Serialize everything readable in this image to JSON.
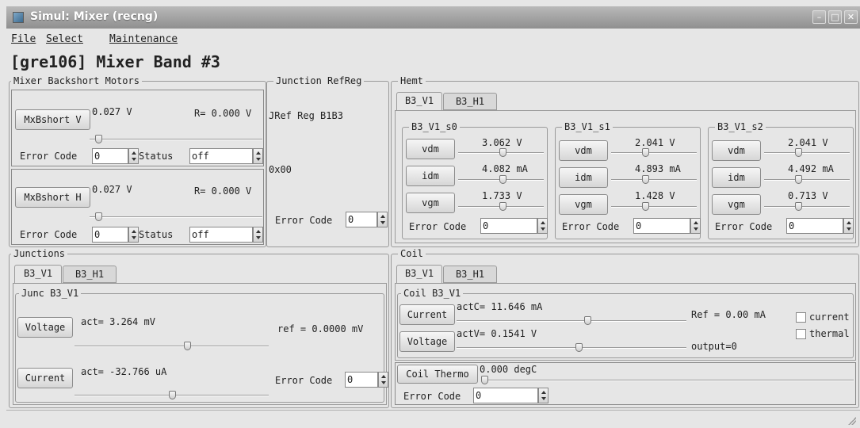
{
  "window": {
    "title": "Simul: Mixer (recng)"
  },
  "menu": {
    "file": "File",
    "select": "Select",
    "maintenance": "Maintenance"
  },
  "heading": "[gre106] Mixer Band #3",
  "motors": {
    "title": "Mixer Backshort Motors",
    "v": {
      "btn": "MxBshort V",
      "volt": "0.027 V",
      "r": "R= 0.000 V",
      "err_label": "Error Code",
      "err": "0",
      "status_label": "Status",
      "status": "off",
      "slider": 0.05
    },
    "h": {
      "btn": "MxBshort H",
      "volt": "0.027 V",
      "r": "R= 0.000 V",
      "err_label": "Error Code",
      "err": "0",
      "status_label": "Status",
      "status": "off",
      "slider": 0.05
    }
  },
  "junction_refreg": {
    "title": "Junction RefReg",
    "name": "JRef Reg B1B3",
    "hex": "0x00",
    "err_label": "Error Code",
    "err": "0"
  },
  "hemt": {
    "title": "Hemt",
    "tabs": [
      "B3_V1",
      "B3_H1"
    ],
    "groups": [
      {
        "title": "B3_V1_s0",
        "vdm_label": "vdm",
        "vdm": "3.062 V",
        "vdm_s": 0.52,
        "idm_label": "idm",
        "idm": "4.082 mA",
        "idm_s": 0.52,
        "vgm_label": "vgm",
        "vgm": "1.733 V",
        "vgm_s": 0.52,
        "err_label": "Error Code",
        "err": "0"
      },
      {
        "title": "B3_V1_s1",
        "vdm_label": "vdm",
        "vdm": "2.041 V",
        "vdm_s": 0.4,
        "idm_label": "idm",
        "idm": "4.893 mA",
        "idm_s": 0.4,
        "vgm_label": "vgm",
        "vgm": "1.428 V",
        "vgm_s": 0.4,
        "err_label": "Error Code",
        "err": "0"
      },
      {
        "title": "B3_V1_s2",
        "vdm_label": "vdm",
        "vdm": "2.041 V",
        "vdm_s": 0.4,
        "idm_label": "idm",
        "idm": "4.492 mA",
        "idm_s": 0.4,
        "vgm_label": "vgm",
        "vgm": "0.713 V",
        "vgm_s": 0.4,
        "err_label": "Error Code",
        "err": "0"
      }
    ]
  },
  "junctions": {
    "title": "Junctions",
    "tabs": [
      "B3_V1",
      "B3_H1"
    ],
    "group_title": "Junc B3_V1",
    "voltage_btn": "Voltage",
    "act_v": "act= 3.264 mV",
    "act_v_s": 0.58,
    "ref": "ref =  0.0000 mV",
    "current_btn": "Current",
    "act_c": "act= -32.766 uA",
    "act_c_s": 0.5,
    "err_label": "Error Code",
    "err": "0"
  },
  "coil": {
    "title": "Coil",
    "tabs": [
      "B3_V1",
      "B3_H1"
    ],
    "group_title": "Coil B3_V1",
    "current_btn": "Current",
    "actC": "actC=   11.646 mA",
    "actC_s": 0.57,
    "ref": "Ref =   0.00 mA",
    "chk_current": "current",
    "voltage_btn": "Voltage",
    "actV": "actV=   0.1541 V",
    "actV_s": 0.53,
    "output": "output=0",
    "chk_thermal": "thermal",
    "thermo_btn": "Coil Thermo",
    "thermo": "0.000 degC",
    "thermo_s": 0.0,
    "err_label": "Error Code",
    "err": "0"
  }
}
